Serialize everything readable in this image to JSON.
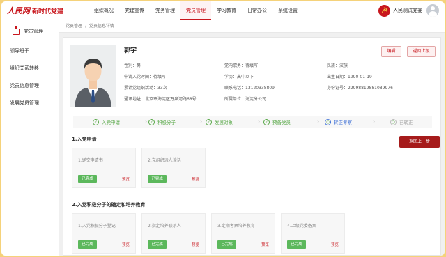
{
  "header": {
    "logo_main": "人民网",
    "logo_sub": "新时代党建",
    "nav": [
      "组织概况",
      "党建宣传",
      "党务管理",
      "党员管理",
      "学习教育",
      "日常办公",
      "系统设置"
    ],
    "active_nav": "党员管理",
    "org_name": "人民测试党委"
  },
  "sidebar": {
    "title": "党员管理",
    "items": [
      "领导班子",
      "组织关系转移",
      "党员信息管理",
      "发展党员管理"
    ]
  },
  "breadcrumb": [
    "党员管理",
    "党员信息详情"
  ],
  "profile": {
    "name": "郭宇",
    "gender": "性别：男",
    "party_position": "党内职务：待填写",
    "ethnicity": "民族：汉族",
    "application_date": "申请入党时间：待填写",
    "education": "学历：高中以下",
    "birth_date": "出生日期：1990-01-19",
    "activity_count": "累计党组织活动：33次",
    "phone": "联系电话：13120338809",
    "id_number": "身份证号：22998819881089976",
    "address": "通讯地址：北京市海淀区万泉河路68号",
    "unit": "所属单位：海淀分公司"
  },
  "actions": {
    "edit": "编辑",
    "back": "返回上级",
    "back_step": "返回上一步"
  },
  "steps": [
    {
      "label": "入党申请",
      "state": "done"
    },
    {
      "label": "积极分子",
      "state": "done"
    },
    {
      "label": "发展对象",
      "state": "done"
    },
    {
      "label": "预备党员",
      "state": "done"
    },
    {
      "label": "转正考察",
      "state": "current"
    },
    {
      "label": "已转正",
      "state": "todo"
    }
  ],
  "sections": [
    {
      "title": "1.入党申请",
      "tasks": [
        {
          "title": "1.递交申请书",
          "status": "已完成",
          "link": "预览"
        },
        {
          "title": "2.党组织派人谈话",
          "status": "已完成",
          "link": "预览"
        }
      ]
    },
    {
      "title": "2.入党积极分子的确定和培养教育",
      "tasks": [
        {
          "title": "1.入党积极分子登记",
          "status": "已完成",
          "link": "预览"
        },
        {
          "title": "2.指定培养联系人",
          "status": "已完成",
          "link": "预览"
        },
        {
          "title": "3.定期考察培养教育",
          "status": "已完成",
          "link": "预览"
        },
        {
          "title": "4.上级党委备案",
          "status": "已完成",
          "link": "预览"
        }
      ]
    }
  ],
  "colors": {
    "brand_red": "#c8161d",
    "done_green": "#5cb85c",
    "current_blue": "#3d6fd6"
  }
}
